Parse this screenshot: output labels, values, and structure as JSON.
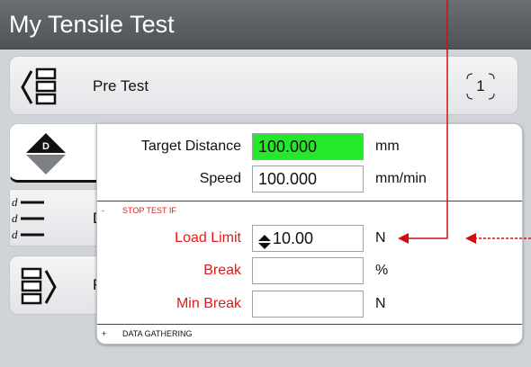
{
  "header": {
    "title": "My Tensile Test"
  },
  "steps": [
    {
      "label": "Pre Test",
      "icon": "pretest-icon",
      "count": "1"
    },
    {
      "label": "D",
      "icon": "data-step-icon"
    },
    {
      "label": "F",
      "icon": "finish-step-icon"
    }
  ],
  "panel": {
    "fields": [
      {
        "label": "Target Distance",
        "value": "100.000",
        "unit": "mm"
      },
      {
        "label": "Speed",
        "value": "100.000",
        "unit": "mm/min"
      }
    ],
    "stop_section": {
      "toggle": "-",
      "title": "STOP TEST IF",
      "fields": [
        {
          "label": "Load Limit",
          "value": "10.00",
          "unit": "N"
        },
        {
          "label": "Break",
          "value": "",
          "unit": "%"
        },
        {
          "label": "Min Break",
          "value": "",
          "unit": "N"
        }
      ]
    },
    "data_section": {
      "toggle": "+",
      "title": "DATA GATHERING"
    }
  },
  "colors": {
    "active_field": "#26e82a",
    "stop_label": "#e11b1b",
    "title_bar": "#5c5f63",
    "annotation_arrow": "#d01010"
  }
}
